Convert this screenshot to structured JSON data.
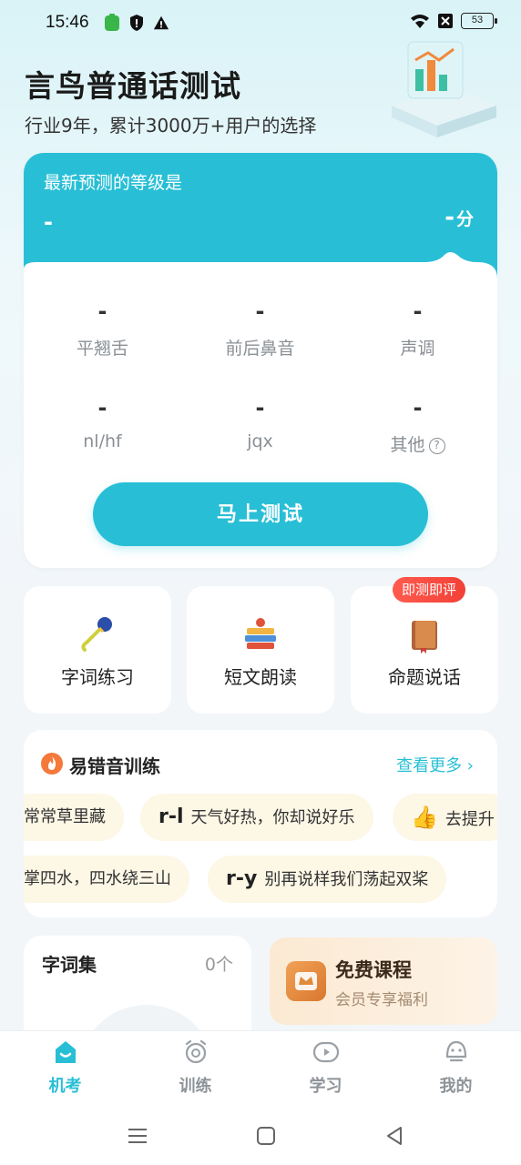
{
  "status": {
    "time": "15:46",
    "battery": "53"
  },
  "hero": {
    "title": "言鸟普通话测试",
    "subtitle": "行业9年，累计3000万+用户的选择"
  },
  "prediction": {
    "label": "最新预测的等级是",
    "level": "-",
    "score": "-",
    "score_unit": "分",
    "stats": [
      {
        "value": "-",
        "label": "平翘舌"
      },
      {
        "value": "-",
        "label": "前后鼻音"
      },
      {
        "value": "-",
        "label": "声调"
      },
      {
        "value": "-",
        "label": "nl/hf"
      },
      {
        "value": "-",
        "label": "jqx"
      },
      {
        "value": "-",
        "label": "其他"
      }
    ],
    "help_icon": "?",
    "button": "马上测试"
  },
  "features": [
    {
      "label": "字词练习",
      "icon": "microphone-icon"
    },
    {
      "label": "短文朗读",
      "icon": "books-icon"
    },
    {
      "label": "命题说话",
      "icon": "notebook-icon",
      "badge": "即测即评"
    }
  ],
  "error_training": {
    "title": "易错音训练",
    "more": "查看更多 ›",
    "row1": [
      {
        "tag": "",
        "text": "常常草里藏"
      },
      {
        "tag": "r-l",
        "text": "天气好热，你却说好乐"
      },
      {
        "tag": "👍",
        "text": "去提升"
      }
    ],
    "row2": [
      {
        "tag": "",
        "text": "掌四水，四水绕三山"
      },
      {
        "tag": "r-y",
        "text": "别再说样我们荡起双桨"
      }
    ]
  },
  "words": {
    "title": "字词集",
    "count": "0个"
  },
  "course": {
    "title": "免费课程",
    "subtitle": "会员专享福利"
  },
  "tabs": [
    {
      "label": "机考",
      "icon": "home-icon",
      "active": true
    },
    {
      "label": "训练",
      "icon": "alarm-icon",
      "active": false
    },
    {
      "label": "学习",
      "icon": "play-icon",
      "active": false
    },
    {
      "label": "我的",
      "icon": "face-icon",
      "active": false
    }
  ],
  "colors": {
    "accent": "#28bfd6",
    "badge": "#f24137",
    "chip": "#fdf7e6"
  }
}
